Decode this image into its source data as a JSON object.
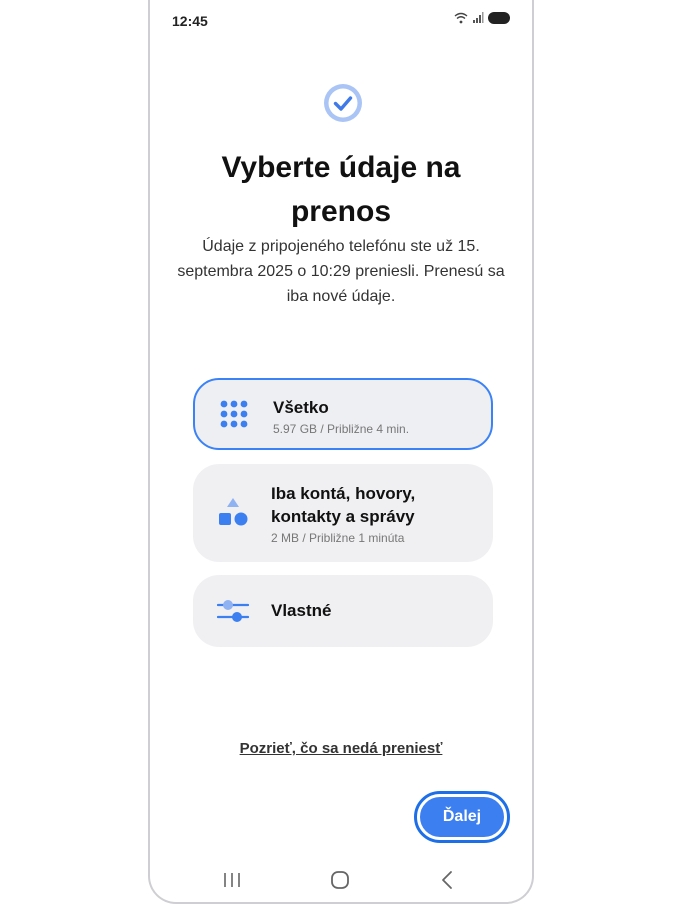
{
  "status": {
    "time": "12:45"
  },
  "screen": {
    "title": "Vyberte údaje na prenos",
    "subtitle": "Údaje z pripojeného telefónu ste už 15. septembra 2025 o 10:29 preniesli. Prenesú sa iba nové údaje."
  },
  "options": [
    {
      "title": "Všetko",
      "subtitle": "5.97 GB / Približne 4 min.",
      "icon": "grid-dots-icon",
      "selected": true
    },
    {
      "title": "Iba kontá, hovory, kontakty a správy",
      "subtitle": "2 MB / Približne 1 minúta",
      "icon": "shapes-icon",
      "selected": false
    },
    {
      "title": "Vlastné",
      "subtitle": "",
      "icon": "sliders-icon",
      "selected": false
    }
  ],
  "link": {
    "label": "Pozrieť, čo sa nedá preniesť"
  },
  "buttons": {
    "next": "Ďalej"
  },
  "colors": {
    "accent": "#3b7ff0",
    "card_bg": "#f0f0f3"
  }
}
